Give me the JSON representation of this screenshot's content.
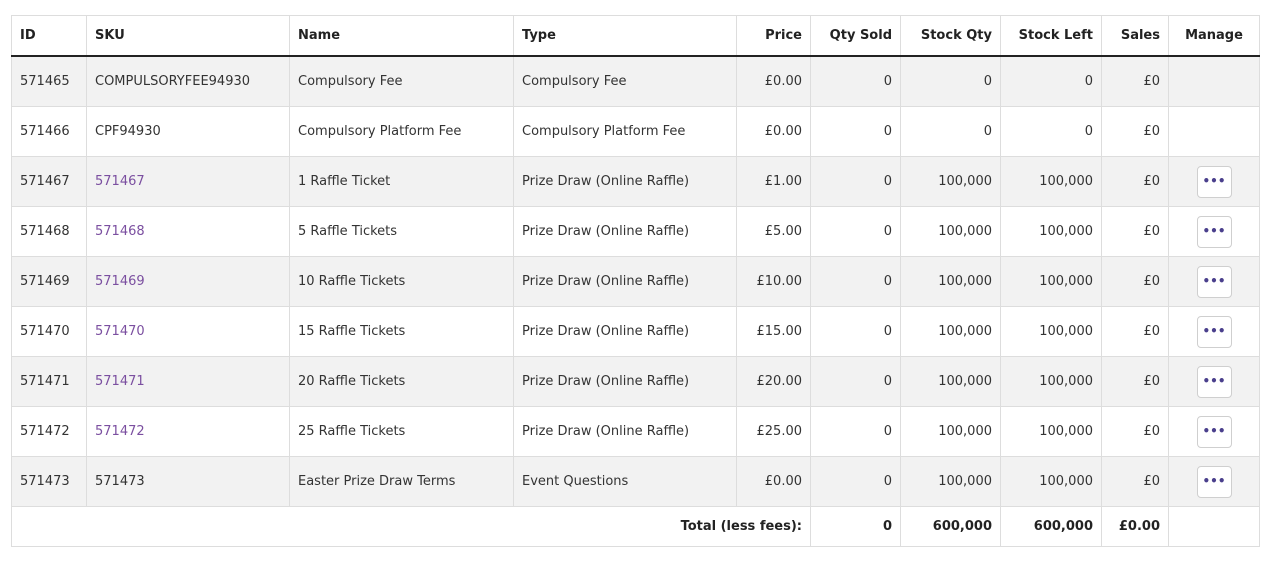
{
  "columns": {
    "id": "ID",
    "sku": "SKU",
    "name": "Name",
    "type": "Type",
    "price": "Price",
    "qty_sold": "Qty Sold",
    "stock_qty": "Stock Qty",
    "stock_left": "Stock Left",
    "sales": "Sales",
    "manage": "Manage"
  },
  "rows": [
    {
      "id": "571465",
      "sku": "COMPULSORYFEE94930",
      "sku_link": false,
      "name": "Compulsory Fee",
      "type": "Compulsory Fee",
      "price": "£0.00",
      "qty_sold": "0",
      "stock_qty": "0",
      "stock_left": "0",
      "sales": "£0",
      "manage": false
    },
    {
      "id": "571466",
      "sku": "CPF94930",
      "sku_link": false,
      "name": "Compulsory Platform Fee",
      "type": "Compulsory Platform Fee",
      "price": "£0.00",
      "qty_sold": "0",
      "stock_qty": "0",
      "stock_left": "0",
      "sales": "£0",
      "manage": false
    },
    {
      "id": "571467",
      "sku": "571467",
      "sku_link": true,
      "name": "1 Raffle Ticket",
      "type": "Prize Draw (Online Raffle)",
      "price": "£1.00",
      "qty_sold": "0",
      "stock_qty": "100,000",
      "stock_left": "100,000",
      "sales": "£0",
      "manage": true
    },
    {
      "id": "571468",
      "sku": "571468",
      "sku_link": true,
      "name": "5 Raffle Tickets",
      "type": "Prize Draw (Online Raffle)",
      "price": "£5.00",
      "qty_sold": "0",
      "stock_qty": "100,000",
      "stock_left": "100,000",
      "sales": "£0",
      "manage": true
    },
    {
      "id": "571469",
      "sku": "571469",
      "sku_link": true,
      "name": "10 Raffle Tickets",
      "type": "Prize Draw (Online Raffle)",
      "price": "£10.00",
      "qty_sold": "0",
      "stock_qty": "100,000",
      "stock_left": "100,000",
      "sales": "£0",
      "manage": true
    },
    {
      "id": "571470",
      "sku": "571470",
      "sku_link": true,
      "name": "15 Raffle Tickets",
      "type": "Prize Draw (Online Raffle)",
      "price": "£15.00",
      "qty_sold": "0",
      "stock_qty": "100,000",
      "stock_left": "100,000",
      "sales": "£0",
      "manage": true
    },
    {
      "id": "571471",
      "sku": "571471",
      "sku_link": true,
      "name": "20 Raffle Tickets",
      "type": "Prize Draw (Online Raffle)",
      "price": "£20.00",
      "qty_sold": "0",
      "stock_qty": "100,000",
      "stock_left": "100,000",
      "sales": "£0",
      "manage": true
    },
    {
      "id": "571472",
      "sku": "571472",
      "sku_link": true,
      "name": "25 Raffle Tickets",
      "type": "Prize Draw (Online Raffle)",
      "price": "£25.00",
      "qty_sold": "0",
      "stock_qty": "100,000",
      "stock_left": "100,000",
      "sales": "£0",
      "manage": true
    },
    {
      "id": "571473",
      "sku": "571473",
      "sku_link": false,
      "name": "Easter Prize Draw Terms",
      "type": "Event Questions",
      "price": "£0.00",
      "qty_sold": "0",
      "stock_qty": "100,000",
      "stock_left": "100,000",
      "sales": "£0",
      "manage": true
    }
  ],
  "totals": {
    "label": "Total (less fees):",
    "qty_sold": "0",
    "stock_qty": "600,000",
    "stock_left": "600,000",
    "sales": "£0.00"
  },
  "manage_button": {
    "icon": "more-horizontal-icon",
    "glyph": "•••"
  },
  "colors": {
    "link": "#7b4fa0",
    "row_shade": "#f2f2f2",
    "border": "#dddddd"
  }
}
